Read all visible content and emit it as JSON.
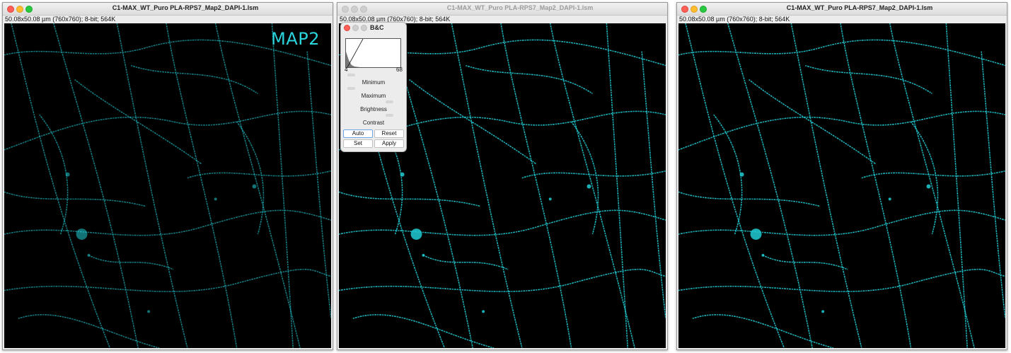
{
  "windows": [
    {
      "title": "C1-MAX_WT_Puro PLA-RPS7_Map2_DAPI-1.lsm",
      "info": "50.08x50.08 µm (760x760); 8-bit; 564K",
      "overlay_label": "MAP2",
      "active": true
    },
    {
      "title": "C1-MAX_WT_Puro PLA-RPS7_Map2_DAPI-1.lsm",
      "info": "50.08x50.08 µm (760x760); 8-bit; 564K",
      "overlay_label": "",
      "active": false
    },
    {
      "title": "C1-MAX_WT_Puro PLA-RPS7_Map2_DAPI-1.lsm",
      "info": "50.08x50.08 µm (760x760); 8-bit; 564K",
      "overlay_label": "",
      "active": true
    }
  ],
  "bc_panel": {
    "title": "B&C",
    "histogram_min": "4",
    "histogram_max": "68",
    "sliders": [
      {
        "label": "Minimum",
        "value": 0.05
      },
      {
        "label": "Maximum",
        "value": 0.05
      },
      {
        "label": "Brightness",
        "value": 0.82
      },
      {
        "label": "Contrast",
        "value": 0.82
      }
    ],
    "buttons": {
      "auto": "Auto",
      "reset": "Reset",
      "set": "Set",
      "apply": "Apply"
    }
  },
  "colors": {
    "fiber": "#20c8d0",
    "image_background": "#000000",
    "overlay_text": "#2ad4dc"
  }
}
